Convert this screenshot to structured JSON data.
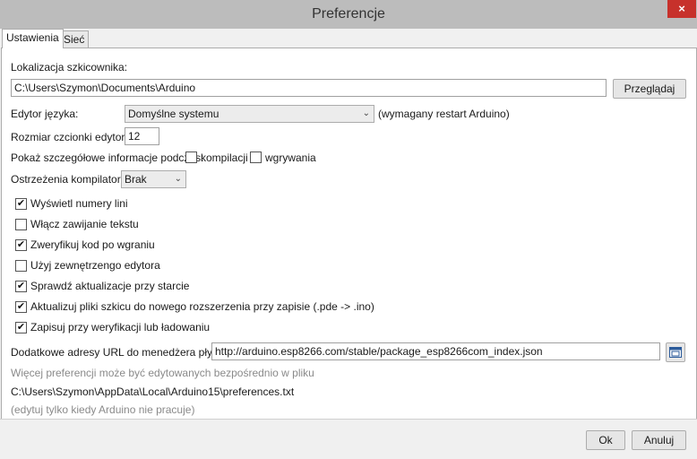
{
  "window": {
    "title": "Preferencje",
    "close_glyph": "×"
  },
  "tabs": [
    {
      "label": "Ustawienia",
      "active": true
    },
    {
      "label": "Sieć",
      "active": false
    }
  ],
  "sketchbook": {
    "label": "Lokalizacja szkicownika:",
    "value": "C:\\Users\\Szymon\\Documents\\Arduino",
    "browse_label": "Przeglądaj"
  },
  "editor_language": {
    "label": "Edytor języka:",
    "selected": "Domyślne systemu",
    "note": "(wymagany restart Arduino)"
  },
  "font_size": {
    "label": "Rozmiar czcionki edytora:",
    "value": "12"
  },
  "verbose": {
    "label": "Pokaż szczegółowe informacje podczas:",
    "compile_label": "kompilacji",
    "compile_checked": false,
    "upload_label": "wgrywania",
    "upload_checked": false
  },
  "compiler_warnings": {
    "label": "Ostrzeżenia kompilatora:",
    "selected": "Brak"
  },
  "checkboxes": [
    {
      "label": "Wyświetl numery lini",
      "checked": true
    },
    {
      "label": "Włącz zawijanie tekstu",
      "checked": false
    },
    {
      "label": "Zweryfikuj kod po wgraniu",
      "checked": true
    },
    {
      "label": "Użyj zewnętrzengo edytora",
      "checked": false
    },
    {
      "label": "Sprawdź aktualizacje przy starcie",
      "checked": true
    },
    {
      "label": "Aktualizuj pliki szkicu do nowego rozszerzenia przy zapisie (.pde -> .ino)",
      "checked": true
    },
    {
      "label": "Zapisuj przy weryfikacji lub ładowaniu",
      "checked": true
    }
  ],
  "board_urls": {
    "label": "Dodatkowe adresy URL do menedżera płytek:",
    "value": "http://arduino.esp8266.com/stable/package_esp8266com_index.json",
    "icon": "window-icon"
  },
  "more_prefs": {
    "note": "Więcej preferencji może być edytowanych bezpośrednio w pliku",
    "path": "C:\\Users\\Szymon\\AppData\\Local\\Arduino15\\preferences.txt",
    "hint": "(edytuj tylko kiedy Arduino nie pracuje)"
  },
  "footer": {
    "ok_label": "Ok",
    "cancel_label": "Anuluj"
  },
  "colors": {
    "titlebar": "#bcbcbc",
    "close": "#c7312b",
    "check": "✔"
  }
}
